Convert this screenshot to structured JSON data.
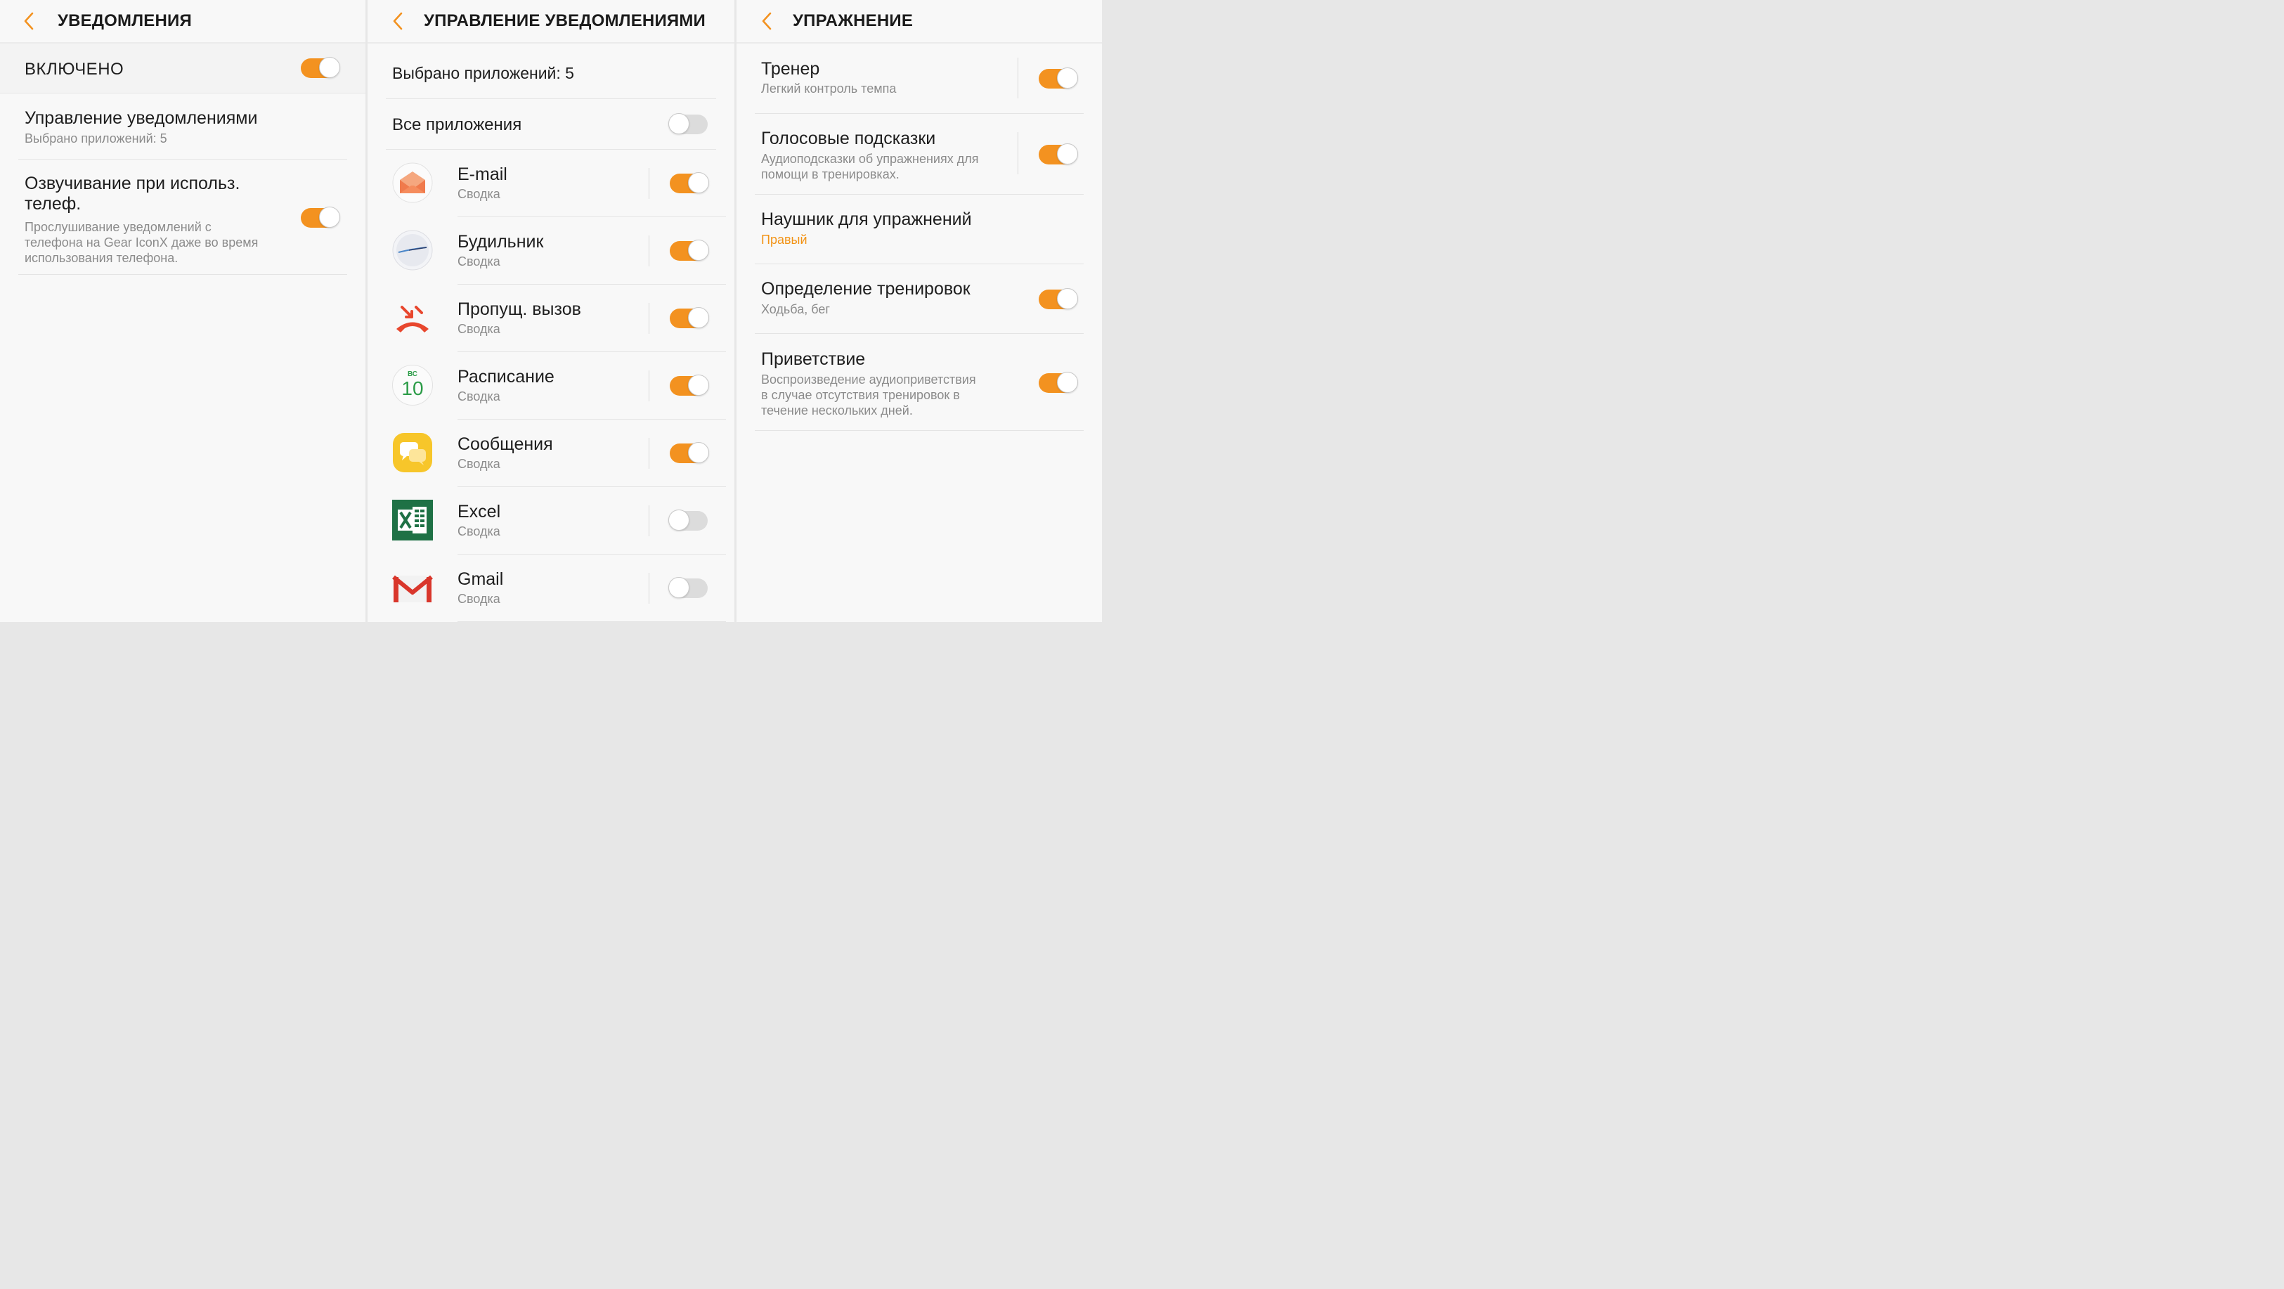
{
  "accent_color": "#f39220",
  "screen1": {
    "title": "УВЕДОМЛЕНИЯ",
    "back_icon": "chevron-left-icon",
    "enabled": {
      "label": "ВКЛЮЧЕНО",
      "on": true
    },
    "manage": {
      "title": "Управление уведомлениями",
      "subtitle": "Выбрано приложений: 5"
    },
    "speak": {
      "title_line1": "Озвучивание при использ.",
      "title_line2": "телеф.",
      "desc_line1": "Прослушивание уведомлений с",
      "desc_line2": "телефона на Gear IconX даже во время",
      "desc_line3": "использования телефона.",
      "on": true
    }
  },
  "screen2": {
    "title": "УПРАВЛЕНИЕ УВЕДОМЛЕНИЯМИ",
    "selected_count": "Выбрано приложений: 5",
    "all_apps": {
      "label": "Все приложения",
      "on": false
    },
    "apps": [
      {
        "name": "E-mail",
        "sub": "Сводка",
        "icon": "email-icon",
        "on": true
      },
      {
        "name": "Будильник",
        "sub": "Сводка",
        "icon": "alarm-icon",
        "on": true
      },
      {
        "name": "Пропущ. вызов",
        "sub": "Сводка",
        "icon": "missed-call-icon",
        "on": true
      },
      {
        "name": "Расписание",
        "sub": "Сводка",
        "icon": "calendar-icon",
        "icon_day": "ВС",
        "icon_date": "10",
        "on": true
      },
      {
        "name": "Сообщения",
        "sub": "Сводка",
        "icon": "messages-icon",
        "on": true
      },
      {
        "name": "Excel",
        "sub": "Сводка",
        "icon": "excel-icon",
        "on": false
      },
      {
        "name": "Gmail",
        "sub": "Сводка",
        "icon": "gmail-icon",
        "on": false
      }
    ]
  },
  "screen3": {
    "title": "УПРАЖНЕНИЕ",
    "coach": {
      "title": "Тренер",
      "subtitle": "Легкий контроль темпа",
      "on": true
    },
    "voice": {
      "title": "Голосовые подсказки",
      "desc_line1": "Аудиоподсказки об упражнениях для",
      "desc_line2": "помощи в тренировках.",
      "on": true
    },
    "earbud": {
      "title": "Наушник для упражнений",
      "value": "Правый"
    },
    "detect": {
      "title": "Определение тренировок",
      "subtitle": "Ходьба, бег",
      "on": true
    },
    "greeting": {
      "title": "Приветствие",
      "desc_line1": "Воспроизведение аудиоприветствия",
      "desc_line2": "в случае отсутствия тренировок в",
      "desc_line3": "течение нескольких дней.",
      "on": true
    }
  }
}
